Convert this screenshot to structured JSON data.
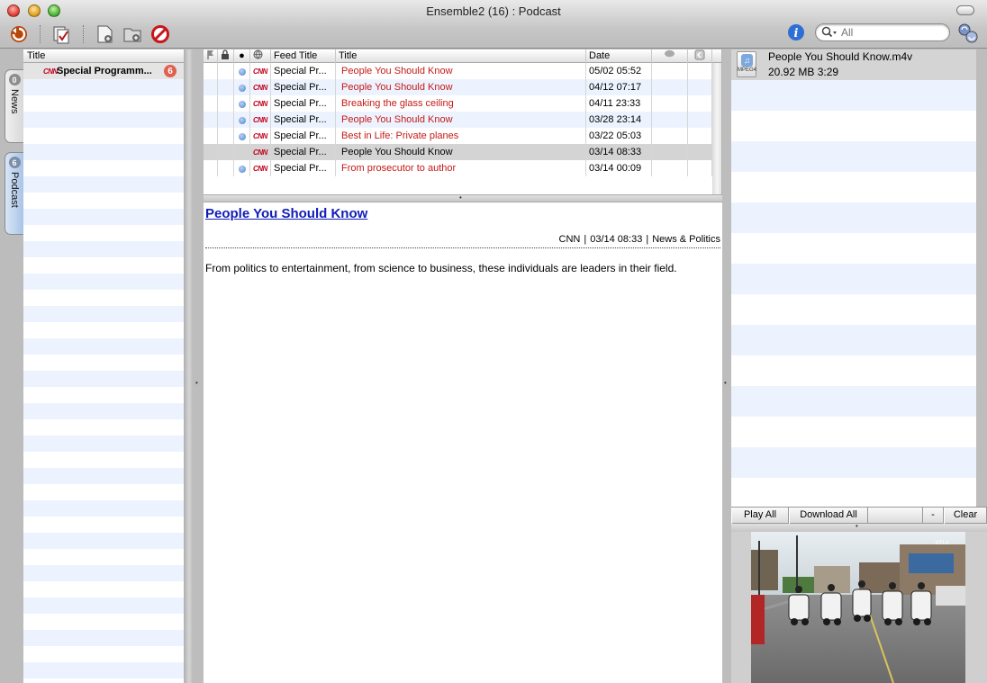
{
  "window": {
    "title": "Ensemble2 (16) : Podcast"
  },
  "search": {
    "placeholder": "All",
    "value": ""
  },
  "sidetabs": [
    {
      "label": "News",
      "badge": "0"
    },
    {
      "label": "Podcast",
      "badge": "6"
    }
  ],
  "left": {
    "header": "Title",
    "feeds": [
      {
        "logo": "CNN",
        "title": "Special Programm...",
        "count": "6"
      }
    ]
  },
  "list": {
    "headers": {
      "feed_title": "Feed Title",
      "title": "Title",
      "date": "Date"
    },
    "rows": [
      {
        "unread": true,
        "logo": "CNN",
        "feed": "Special Pr...",
        "title": "People You Should Know",
        "date": "05/02 05:52",
        "red": true
      },
      {
        "unread": true,
        "logo": "CNN",
        "feed": "Special Pr...",
        "title": "People You Should Know",
        "date": "04/12 07:17",
        "red": true
      },
      {
        "unread": true,
        "logo": "CNN",
        "feed": "Special Pr...",
        "title": "Breaking the glass ceiling",
        "date": "04/11 23:33",
        "red": true
      },
      {
        "unread": true,
        "logo": "CNN",
        "feed": "Special Pr...",
        "title": "People You Should Know",
        "date": "03/28 23:14",
        "red": true
      },
      {
        "unread": true,
        "logo": "CNN",
        "feed": "Special Pr...",
        "title": "Best in Life: Private planes",
        "date": "03/22 05:03",
        "red": true
      },
      {
        "unread": false,
        "logo": "CNN",
        "feed": "Special Pr...",
        "title": "People You Should Know",
        "date": "03/14 08:33",
        "red": false,
        "selected": true
      },
      {
        "unread": true,
        "logo": "CNN",
        "feed": "Special Pr...",
        "title": "From prosecutor to author",
        "date": "03/14 00:09",
        "red": true
      }
    ]
  },
  "article": {
    "title": "People You Should Know",
    "source": "CNN",
    "datetime": "03/14 08:33",
    "category": "News & Politics",
    "separator": "|",
    "body": "From politics to entertainment, from science to business, these individuals are leaders in their field."
  },
  "enclosure": {
    "icon_label": "MPEG4",
    "filename": "People You Should Know.m4v",
    "info": "20.92 MB 3:29"
  },
  "enclosure_toolbar": {
    "play_all": "Play All",
    "download_all": "Download All",
    "minus": "-",
    "clear": "Clear"
  },
  "video": {
    "watermark": "KTLA"
  },
  "icons": {
    "refresh": "refresh-icon",
    "mark_read": "mark-read-icon",
    "new_feed": "new-feed-icon",
    "new_folder": "new-folder-icon",
    "delete": "delete-icon",
    "info": "info-icon",
    "search": "search-icon",
    "sync": "sync-icon"
  },
  "colors": {
    "unread_red": "#c41a16",
    "link_blue": "#0f1cb8",
    "badge_red": "#e0604f",
    "stripe": "#edf3fe"
  }
}
